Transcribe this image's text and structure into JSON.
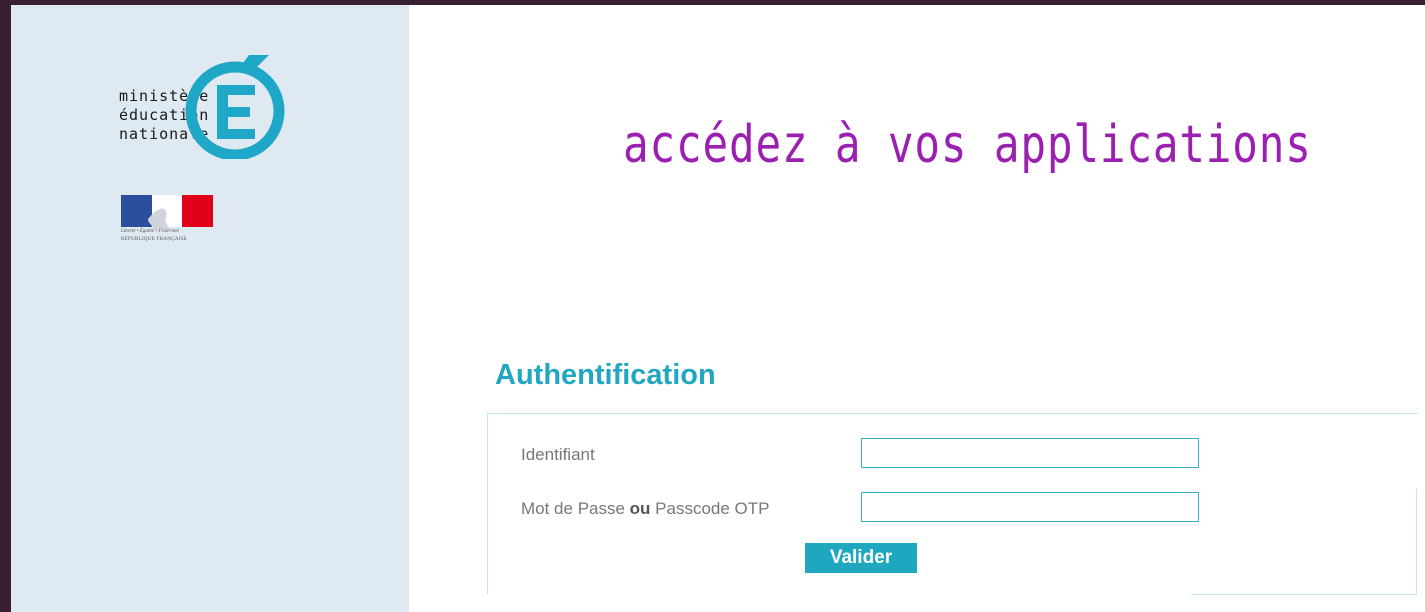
{
  "sidebar": {
    "logo": {
      "line1": "ministère",
      "line2": "éducation",
      "line3": "nationale",
      "emblem_letter": "É",
      "emblem_color": "#1fa7c7"
    },
    "marianne": {
      "motto": "Liberté • Égalité • Fraternité",
      "country": "RÉPUBLIQUE FRANÇAISE",
      "flag_colors": [
        "#2b4f9e",
        "#ffffff",
        "#e1001a"
      ]
    },
    "background": "#dfe9f2"
  },
  "main": {
    "headline": "accédez à vos applications",
    "headline_color": "#9b1fb0"
  },
  "auth": {
    "title": "Authentification",
    "title_color": "#22a7c0",
    "username_label": "Identifiant",
    "username_value": "",
    "password_label_part1": "Mot de Passe ",
    "password_label_or": "ou",
    "password_label_part2": " Passcode OTP",
    "password_value": "",
    "submit_label": "Valider",
    "accent": "#1ea7bf"
  }
}
